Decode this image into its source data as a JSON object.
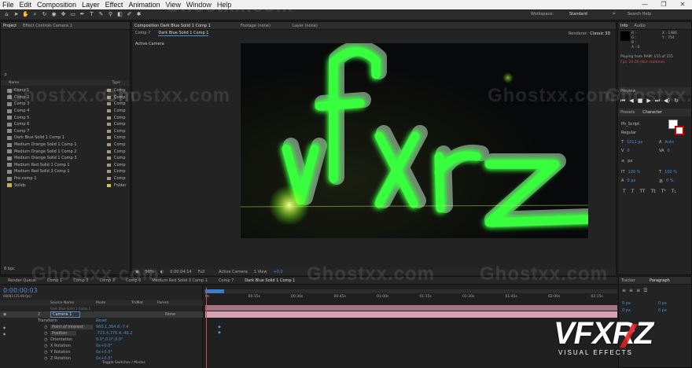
{
  "menu": [
    "File",
    "Edit",
    "Composition",
    "Layer",
    "Effect",
    "Animation",
    "View",
    "Window",
    "Help"
  ],
  "window_controls": [
    "—",
    "❐",
    "✕"
  ],
  "workspace": {
    "label": "Workspace:",
    "value": "Standard"
  },
  "search_help": "Search Help",
  "watermark": "Ghostxx.com",
  "project": {
    "tabs": [
      "Project",
      "Effect Controls Camera 1"
    ],
    "search_placeholder": "⌕",
    "columns": [
      "Name",
      "Type"
    ],
    "items": [
      {
        "name": "Comp 1",
        "type": "Comp",
        "color": "#a59a80"
      },
      {
        "name": "Comp 2",
        "type": "Comp",
        "color": "#a59a80"
      },
      {
        "name": "Comp 3",
        "type": "Comp",
        "color": "#a59a80"
      },
      {
        "name": "Comp 4",
        "type": "Comp",
        "color": "#a59a80"
      },
      {
        "name": "Comp 5",
        "type": "Comp",
        "color": "#a59a80"
      },
      {
        "name": "Comp 6",
        "type": "Comp",
        "color": "#a59a80"
      },
      {
        "name": "Comp 7",
        "type": "Comp",
        "color": "#a59a80"
      },
      {
        "name": "Dark Blue Solid 1 Comp 1",
        "type": "Comp",
        "color": "#a59a80"
      },
      {
        "name": "Medium Orange Solid 1 Comp 1",
        "type": "Comp",
        "color": "#a59a80"
      },
      {
        "name": "Medium Orange Solid 1 Comp 2",
        "type": "Comp",
        "color": "#a59a80"
      },
      {
        "name": "Medium Orange Solid 1 Comp 3",
        "type": "Comp",
        "color": "#a59a80"
      },
      {
        "name": "Medium Red Solid 1 Comp 1",
        "type": "Comp",
        "color": "#a59a80"
      },
      {
        "name": "Medium Red Solid 3 Comp 1",
        "type": "Comp",
        "color": "#a59a80"
      },
      {
        "name": "Pre-comp 1",
        "type": "Comp",
        "color": "#a59a80"
      },
      {
        "name": "Solids",
        "type": "Folder",
        "color": "#d8c44a"
      }
    ],
    "bpc": "8 bpc"
  },
  "composition": {
    "tabs": [
      "Composition Dark Blue Solid 1 Comp 1",
      "Footage (none)",
      "Layer (none)"
    ],
    "subtabs": [
      "Comp 7",
      "Dark Blue Solid 1 Comp 1"
    ],
    "renderer": {
      "label": "Renderer:",
      "value": "Classic 3D"
    },
    "active_camera": "Active Camera",
    "footer": {
      "zoom": "50%",
      "timecode": "0:00:04:14",
      "resolution": "Full",
      "camera": "Active Camera",
      "view": "1 View",
      "exposure": "+0.0"
    }
  },
  "info": {
    "tabs": [
      "Info",
      "Audio"
    ],
    "rgba": [
      "R :",
      "G :",
      "B :",
      "A : 0"
    ],
    "xy": [
      "X : 1486",
      "Y : 754"
    ],
    "status_line1": "Playing from RAM: 155 of 155",
    "status_line2": "Fps: 25.00 (Not realtime)"
  },
  "preview": {
    "title": "Preview"
  },
  "character": {
    "tabs": [
      "Presets",
      "Character"
    ],
    "font": "Ph_Script",
    "style": "Regular",
    "size": "1011 px",
    "leading": "Auto",
    "kerning": "0",
    "tracking": "0",
    "stroke_unit": "px",
    "vscale": "100 %",
    "hscale": "100 %",
    "baseline": "0 px",
    "tsume": "0 %",
    "styles": [
      "T",
      "T",
      "TT",
      "Tt",
      "T¹",
      "T₁"
    ]
  },
  "paragraph": {
    "tabs": [
      "Tracker",
      "Paragraph"
    ],
    "indent": [
      "0 px",
      "0 px",
      "0 px",
      "0 px",
      "0 px"
    ]
  },
  "bottom_tabs": [
    "Render Queue",
    "Comp 1",
    "Comp 2",
    "Comp 3",
    "Comp 6",
    "Medium Red Solid 3 Comp 1",
    "Comp 7",
    "Dark Blue Solid 1 Comp 1"
  ],
  "timeline": {
    "timecode": "0:00:00:03",
    "fps": "00003 (25.00 fps)",
    "columns": [
      "Source Name",
      "Mode",
      "TrkMat",
      "Parent"
    ],
    "layer1": "Dark Blue Solid 1 Comp 1",
    "layer2": {
      "num": "2",
      "name": "Camera 1",
      "parent": "None"
    },
    "transform": "Transform",
    "reset": "Reset",
    "properties": [
      {
        "name": "Point of Interest",
        "value": "960.1,364.8,-7.4"
      },
      {
        "name": "Position",
        "value": "-723.4,776.4,-46.2"
      },
      {
        "name": "Orientation",
        "value": "0.0°,0.0°,0.0°"
      },
      {
        "name": "X Rotation",
        "value": "0x+0.0°"
      },
      {
        "name": "Y Rotation",
        "value": "0x+0.0°"
      },
      {
        "name": "Z Rotation",
        "value": "0x+0.0°"
      }
    ],
    "toggle": "Toggle Switches / Modes",
    "ruler": [
      "0s",
      "00:15s",
      "00:30s",
      "00:45s",
      "01:00s",
      "01:15s",
      "01:30s",
      "01:45s",
      "02:00s",
      "02:15s"
    ]
  },
  "viewport_text": "vfxrz",
  "logo": {
    "text": "VFXRZ",
    "subtitle": "VISUAL EFFECTS"
  },
  "colors": {
    "accent": "#4c8ed8",
    "neon": "#39ff3c",
    "track": "#d7a3b3"
  }
}
